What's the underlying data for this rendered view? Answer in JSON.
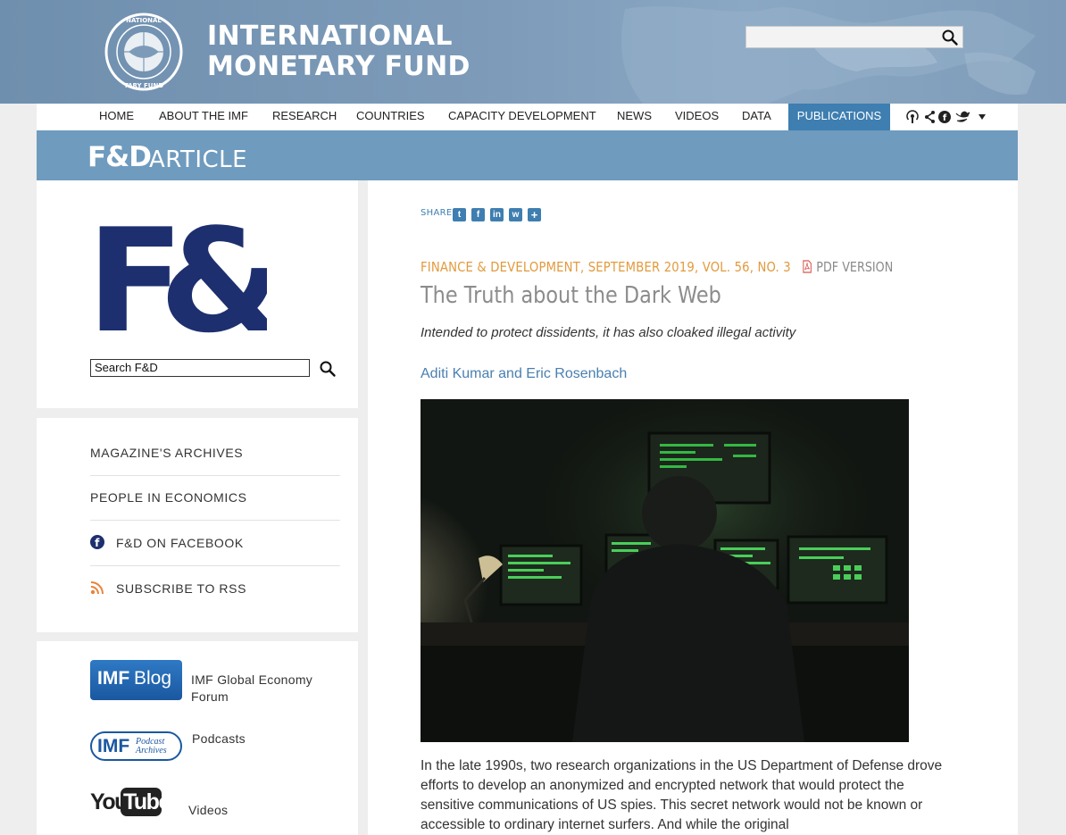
{
  "header": {
    "org_line1": "INTERNATIONAL",
    "org_line2": "MONETARY FUND",
    "search_placeholder": ""
  },
  "nav": {
    "items": [
      {
        "label": "HOME"
      },
      {
        "label": "ABOUT THE IMF"
      },
      {
        "label": "RESEARCH"
      },
      {
        "label": "COUNTRIES"
      },
      {
        "label": "CAPACITY DEVELOPMENT"
      },
      {
        "label": "NEWS"
      },
      {
        "label": "VIDEOS"
      },
      {
        "label": "DATA"
      },
      {
        "label": "PUBLICATIONS",
        "active": true
      }
    ],
    "icons": [
      "podcast-icon",
      "share-icon",
      "facebook-icon",
      "twitter-icon",
      "caret-down-icon"
    ]
  },
  "band": {
    "fd": "F&D",
    "article": "ARTICLE"
  },
  "sidebar": {
    "logo_text": "F&D",
    "search_value": "Search F&D",
    "links": [
      {
        "label": "MAGAZINE'S ARCHIVES",
        "icon": ""
      },
      {
        "label": "PEOPLE IN ECONOMICS",
        "icon": ""
      },
      {
        "label": "F&D ON FACEBOOK",
        "icon": "facebook-icon"
      },
      {
        "label": "SUBSCRIBE TO RSS",
        "icon": "rss-icon"
      }
    ],
    "media": [
      {
        "logo_text_a": "IMF",
        "logo_text_b": "Blog",
        "label": "IMF Global Economy Forum"
      },
      {
        "logo_text_a": "IMF",
        "logo_text_b": "Podcast Archives",
        "label": "Podcasts"
      },
      {
        "logo_text_a": "You",
        "logo_text_b": "Tube",
        "label": "Videos"
      }
    ]
  },
  "article": {
    "share_label": "SHARE:",
    "share_icons": [
      "twitter-icon",
      "facebook-icon",
      "linkedin-icon",
      "weibo-icon",
      "plus-icon"
    ],
    "issue": "FINANCE & DEVELOPMENT, SEPTEMBER 2019, VOL. 56, NO. 3",
    "pdf_label": "PDF VERSION",
    "title": "The Truth about the Dark Web",
    "subtitle": "Intended to protect dissidents, it has also cloaked illegal activity",
    "authors": "Aditi Kumar and Eric Rosenbach",
    "body": "In the late 1990s, two research organizations in the US Department of Defense drove efforts to develop an anonymized and encrypted network that would protect the sensitive communications of US spies. This secret network would not be known or accessible to ordinary internet surfers. And while the original"
  },
  "colors": {
    "header_blue": "#7d9bb9",
    "nav_active": "#3e7eb0",
    "band": "#6f9bbe",
    "issue_orange": "#e29a3d",
    "fd_navy": "#1d2f6f",
    "fd_gold": "#f4b400"
  }
}
